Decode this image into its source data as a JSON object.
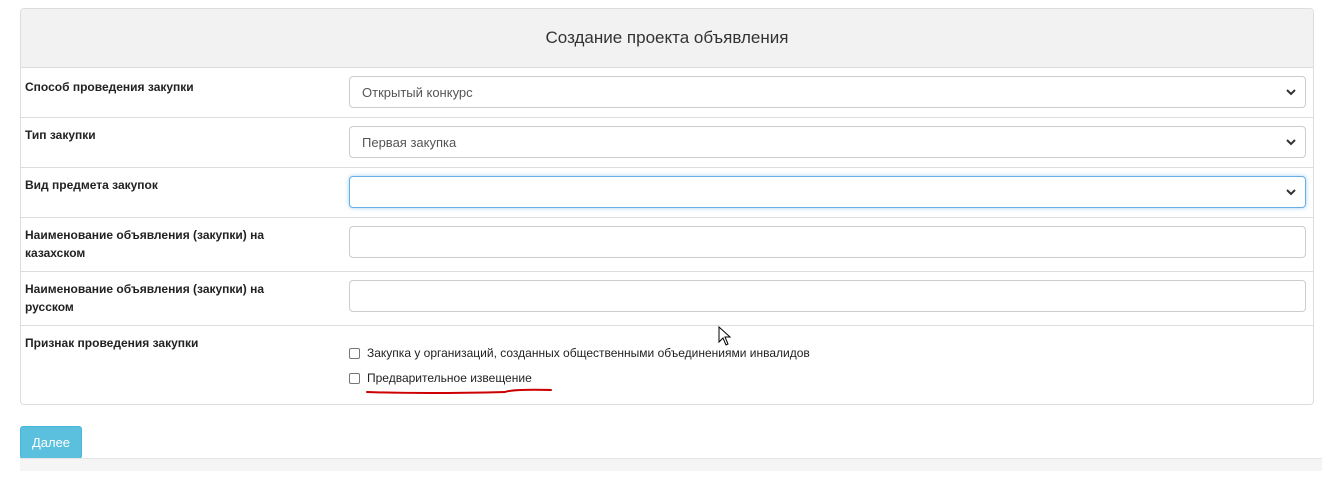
{
  "form": {
    "title": "Создание проекта объявления",
    "rows": [
      {
        "label": "Способ проведения закупки",
        "value": "Открытый конкурс"
      },
      {
        "label": "Тип закупки",
        "value": "Первая закупка"
      },
      {
        "label": "Вид предмета закупок",
        "value": ""
      },
      {
        "label": "Наименование объявления (закупки) на казахском",
        "value": ""
      },
      {
        "label": "Наименование объявления (закупки) на русском",
        "value": ""
      },
      {
        "label": "Признак проведения закупки"
      }
    ],
    "checkboxes": [
      {
        "label": "Закупка у организаций, созданных общественными объединениями инвалидов",
        "checked": false
      },
      {
        "label": "Предварительное извещение",
        "checked": false
      }
    ],
    "submit_label": "Далее"
  },
  "colors": {
    "header_bg": "#f2f2f2",
    "button_bg": "#5bc0de",
    "annotation": "#cc0000"
  }
}
